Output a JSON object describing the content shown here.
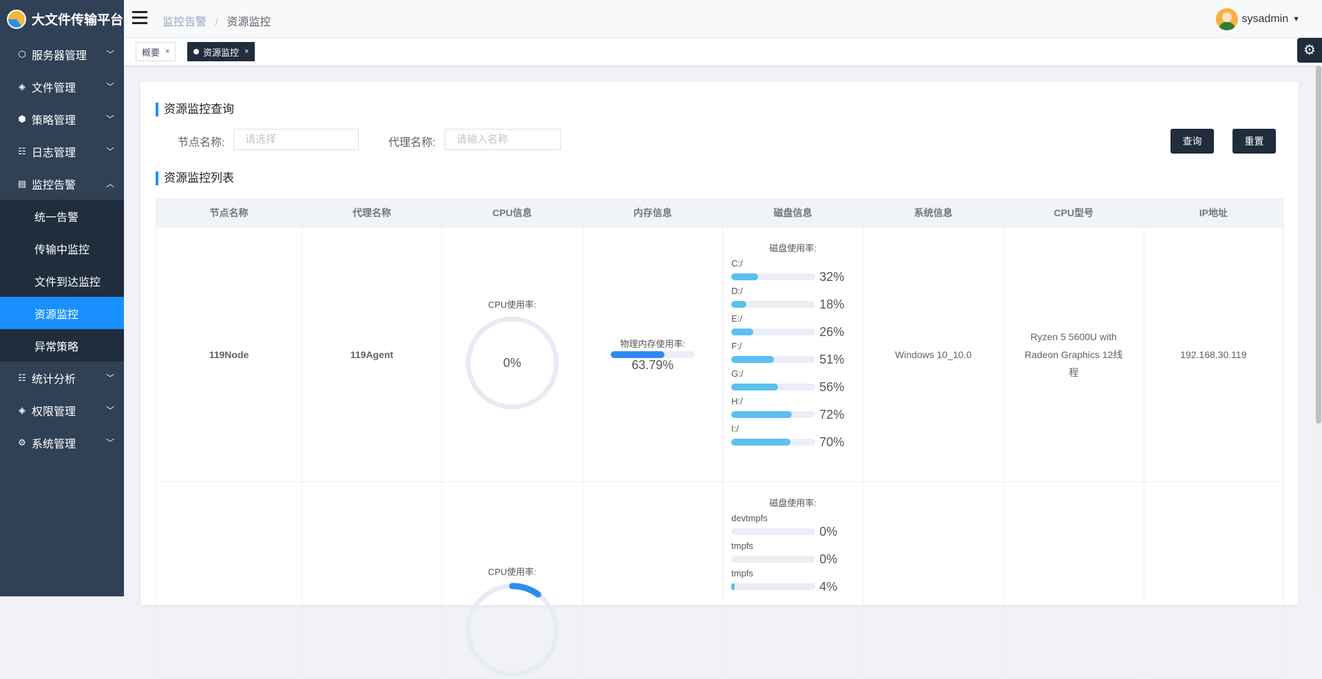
{
  "app": {
    "title": "大文件传输平台"
  },
  "sidebar": {
    "items": [
      {
        "label": "服务器管理",
        "icon": "cube-icon",
        "glyph": "⬡",
        "expanded": false
      },
      {
        "label": "文件管理",
        "icon": "layers-icon",
        "glyph": "◈",
        "expanded": false
      },
      {
        "label": "策略管理",
        "icon": "package-icon",
        "glyph": "⬢",
        "expanded": false
      },
      {
        "label": "日志管理",
        "icon": "list-icon",
        "glyph": "☷",
        "expanded": false
      },
      {
        "label": "监控告警",
        "icon": "monitor-icon",
        "glyph": "▤",
        "expanded": true
      },
      {
        "label": "统计分析",
        "icon": "list-icon",
        "glyph": "☷",
        "expanded": false
      },
      {
        "label": "权限管理",
        "icon": "layers-icon",
        "glyph": "◈",
        "expanded": false
      },
      {
        "label": "系统管理",
        "icon": "gear-icon",
        "glyph": "⚙",
        "expanded": false
      }
    ],
    "submenu": [
      {
        "label": "统一告警"
      },
      {
        "label": "传输中监控"
      },
      {
        "label": "文件到达监控"
      },
      {
        "label": "资源监控",
        "active": true
      },
      {
        "label": "异常策略"
      }
    ]
  },
  "header": {
    "breadcrumb": [
      "监控告警",
      "资源监控"
    ],
    "username": "sysadmin"
  },
  "tags": [
    {
      "label": "概要",
      "active": false
    },
    {
      "label": "资源监控",
      "active": true
    }
  ],
  "query": {
    "title": "资源监控查询",
    "node_label": "节点名称:",
    "node_placeholder": "请选择",
    "agent_label": "代理名称:",
    "agent_placeholder": "请输入名称",
    "search_btn": "查询",
    "reset_btn": "重置"
  },
  "list": {
    "title": "资源监控列表",
    "columns": [
      "节点名称",
      "代理名称",
      "CPU信息",
      "内存信息",
      "磁盘信息",
      "系统信息",
      "CPU型号",
      "IP地址"
    ],
    "rows": [
      {
        "node": "119Node",
        "agent": "119Agent",
        "cpu_label": "CPU使用率:",
        "cpu_value": "0%",
        "cpu_pct": 0,
        "mem_label": "物理内存使用率:",
        "mem_value": "63.79%",
        "mem_pct": 63.79,
        "disk_label": "磁盘使用率:",
        "disks": [
          {
            "name": "C:/",
            "pct": 32,
            "text": "32%"
          },
          {
            "name": "D:/",
            "pct": 18,
            "text": "18%"
          },
          {
            "name": "E:/",
            "pct": 26,
            "text": "26%"
          },
          {
            "name": "F:/",
            "pct": 51,
            "text": "51%"
          },
          {
            "name": "G:/",
            "pct": 56,
            "text": "56%"
          },
          {
            "name": "H:/",
            "pct": 72,
            "text": "72%"
          },
          {
            "name": "I:/",
            "pct": 70,
            "text": "70%"
          }
        ],
        "system": "Windows 10_10.0",
        "cpu_model": "Ryzen 5 5600U with Radeon Graphics 12线程",
        "ip": "192.168.30.119"
      },
      {
        "node": "",
        "agent": "",
        "cpu_label": "CPU使用率:",
        "cpu_value": "",
        "cpu_pct": 10,
        "mem_label": "",
        "mem_value": "",
        "disk_label": "磁盘使用率:",
        "disks": [
          {
            "name": "devtmpfs",
            "pct": 0,
            "text": "0%"
          },
          {
            "name": "tmpfs",
            "pct": 0,
            "text": "0%"
          },
          {
            "name": "tmpfs",
            "pct": 4,
            "text": "4%"
          }
        ],
        "system": "",
        "cpu_model": "",
        "ip": ""
      }
    ]
  },
  "colors": {
    "sidebar_bg": "#304156",
    "submenu_bg": "#1f2d3d",
    "active": "#1890ff",
    "button": "#1f2d3d",
    "mem_bar": "#2d8cf0",
    "disk_bar": "#5bc0f0",
    "donut_track": "#e6ebf5"
  }
}
